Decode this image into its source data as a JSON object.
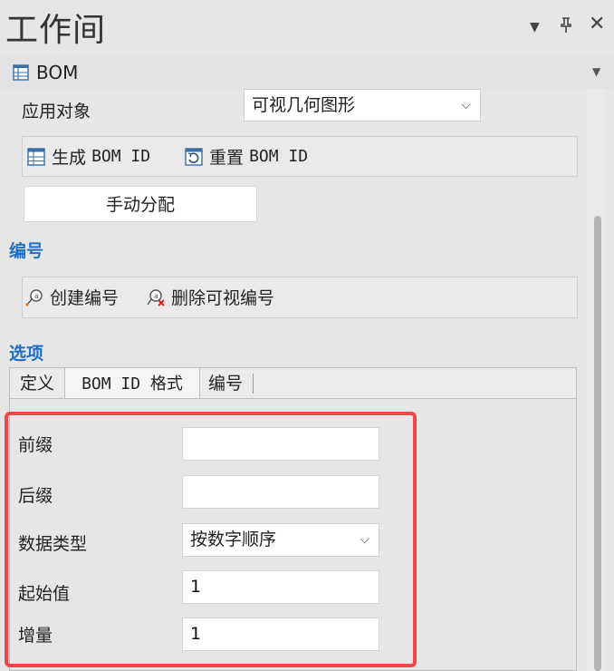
{
  "window": {
    "title": "工作间",
    "controls": [
      "menu",
      "pin",
      "close"
    ]
  },
  "section": {
    "title": "BOM",
    "icon": "table-icon"
  },
  "apply_target": {
    "label": "应用对象",
    "value": "可视几何图形"
  },
  "bom_toolbar": {
    "generate_label": "生成",
    "generate_suffix": "BOM ID",
    "reset_label": "重置",
    "reset_suffix": "BOM ID"
  },
  "manual_assign_label": "手动分配",
  "numbering": {
    "title": "编号",
    "create_label": "创建编号",
    "delete_label": "删除可视编号"
  },
  "options": {
    "title": "选项",
    "tabs": [
      {
        "label": "定义"
      },
      {
        "label": "BOM ID 格式"
      },
      {
        "label": "编号"
      }
    ],
    "active_tab": "BOM ID 格式"
  },
  "format": {
    "prefix_label": "前缀",
    "prefix_value": "",
    "suffix_label": "后缀",
    "suffix_value": "",
    "data_type_label": "数据类型",
    "data_type_value": "按数字顺序",
    "start_label": "起始值",
    "start_value": "1",
    "increment_label": "增量",
    "increment_value": "1"
  },
  "colors": {
    "group_title": "#1f6fc7",
    "highlight": "#f04848"
  }
}
